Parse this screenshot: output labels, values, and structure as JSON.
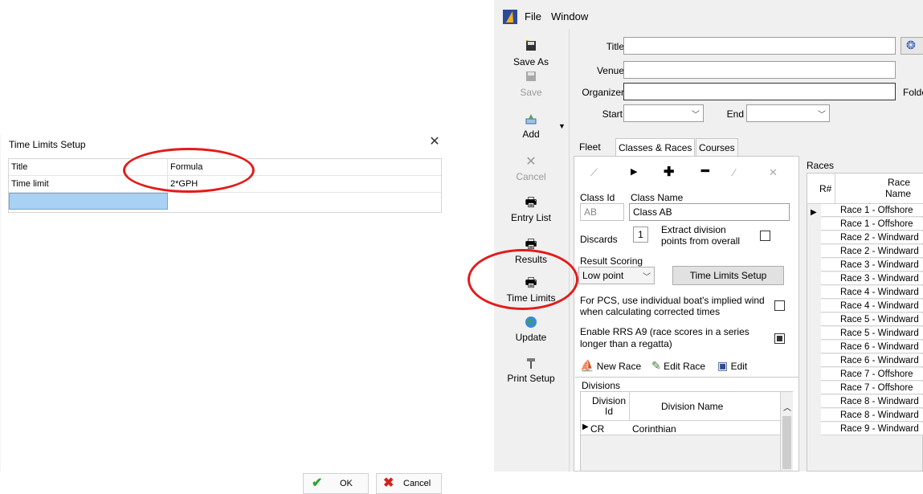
{
  "dialog": {
    "title": "Time Limits Setup",
    "columns": [
      "Title",
      "Formula"
    ],
    "rows": [
      {
        "title": "Time limit",
        "formula": "2*GPH"
      }
    ],
    "ok_label": "OK",
    "cancel_label": "Cancel"
  },
  "app": {
    "menu": [
      "File",
      "Window"
    ],
    "toolbar": {
      "save_as": "Save As",
      "save": "Save",
      "add": "Add",
      "cancel": "Cancel",
      "entry_list": "Entry List",
      "results": "Results",
      "time_limits": "Time Limits",
      "update": "Update",
      "print_setup": "Print Setup"
    },
    "fields": {
      "title_label": "Title",
      "venue_label": "Venue",
      "organizer_label": "Organizer",
      "start_label": "Start",
      "end_label": "End",
      "folder_label": "Folde"
    },
    "tabs": [
      "Fleet",
      "Classes & Races",
      "Courses"
    ],
    "class": {
      "id_label": "Class Id",
      "name_label": "Class Name",
      "id_value": "AB",
      "name_value": "Class AB",
      "discards_label": "Discards",
      "discards_value": "1",
      "extract_label_1": "Extract division",
      "extract_label_2": "points from overall",
      "result_scoring_label": "Result Scoring",
      "result_scoring_value": "Low point",
      "time_limits_setup_label": "Time Limits Setup",
      "pcs_label_1": "For PCS, use individual boat's implied wind",
      "pcs_label_2": "when calculating corrected times",
      "rrs_label_1": "Enable RRS A9 (race scores in a series",
      "rrs_label_2": "longer than a regatta)",
      "rrs_checked": true,
      "new_race": "New Race",
      "edit_race": "Edit Race",
      "edit": "Edit"
    },
    "divisions": {
      "label": "Divisions",
      "col_id_1": "Division",
      "col_id_2": "Id",
      "col_name": "Division Name",
      "rows": [
        {
          "id": "CR",
          "name": "Corinthian"
        }
      ]
    },
    "races": {
      "label": "Races",
      "col_num": "R#",
      "col_name_1": "Race",
      "col_name_2": "Name",
      "rows": [
        "Race 1 - Offshore",
        "Race 1 - Offshore",
        "Race 2 - Windward",
        "Race 2 - Windward",
        "Race 3 - Windward",
        "Race 3 - Windward",
        "Race 4 - Windward",
        "Race 4 - Windward",
        "Race 5 - Windward",
        "Race 5 - Windward",
        "Race 6 - Windward",
        "Race 6 - Windward",
        "Race 7 - Offshore",
        "Race 7 - Offshore",
        "Race 8 - Windward",
        "Race 8 - Windward",
        "Race 9 - Windward"
      ]
    }
  },
  "colors": {
    "highlight_circle": "#e31b1b",
    "selected_cell": "#a9d1f4",
    "ok_check": "#2aa52a",
    "cancel_x": "#d62020"
  }
}
